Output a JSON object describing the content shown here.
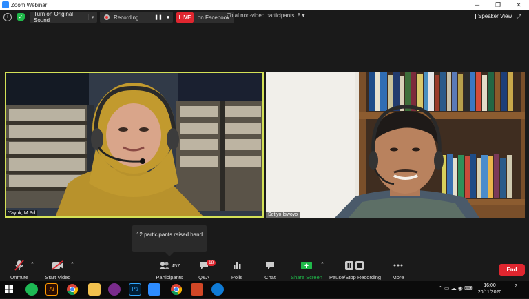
{
  "window": {
    "title": "Zoom Webinar"
  },
  "topbar": {
    "audio_label": "Turn on Original Sound",
    "recording_label": "Recording...",
    "live_label": "LIVE",
    "facebook_label": "on Facebook",
    "non_video_label": "Total non-video participants: 8",
    "speaker_view_label": "Speaker View"
  },
  "videos": [
    {
      "name": "Yayuk, M.Pd"
    },
    {
      "name": "Setiyo Iswoyo"
    }
  ],
  "toast": {
    "text": "12 participants raised hand"
  },
  "controls": {
    "unmute": "Unmute",
    "start_video": "Start Video",
    "participants": "Participants",
    "participants_count": "457",
    "qa": "Q&A",
    "qa_badge": "18",
    "polls": "Polls",
    "chat": "Chat",
    "share_screen": "Share Screen",
    "pause_stop_recording": "Pause/Stop Recording",
    "more": "More",
    "end": "End"
  },
  "taskbar": {
    "time": "16:00",
    "date": "20/11/2020",
    "notifications": "2"
  },
  "colors": {
    "zoom_blue": "#2d8cff",
    "live_red": "#e0262f",
    "share_green": "#20b94a",
    "active_speaker_border": "#d4e157"
  }
}
